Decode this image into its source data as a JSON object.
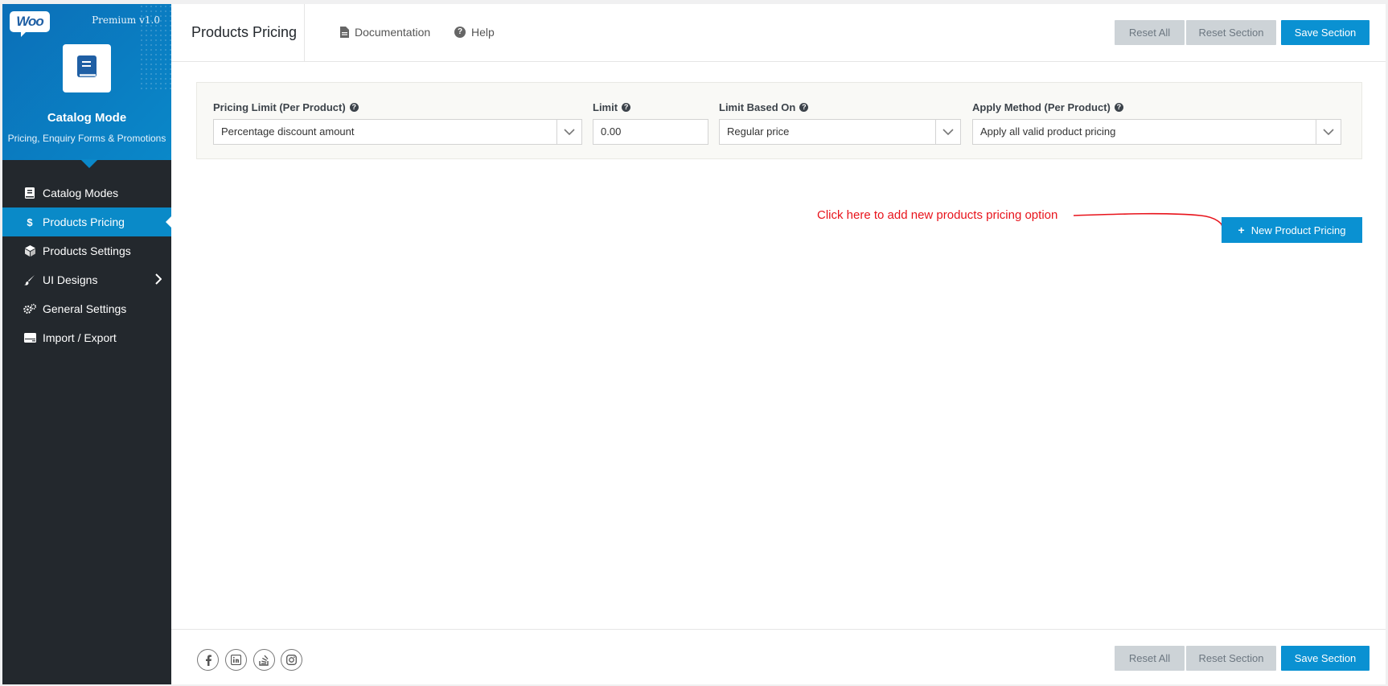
{
  "sidebar": {
    "logo_text": "Woo",
    "version": "Premium v1.0",
    "title": "Catalog Mode",
    "subtitle": "Pricing, Enquiry Forms & Promotions",
    "items": [
      {
        "label": "Catalog Modes",
        "icon": "book-icon"
      },
      {
        "label": "Products Pricing",
        "icon": "dollar-icon",
        "active": true
      },
      {
        "label": "Products Settings",
        "icon": "cube-icon"
      },
      {
        "label": "UI Designs",
        "icon": "brush-icon"
      },
      {
        "label": "General Settings",
        "icon": "cogs-icon"
      },
      {
        "label": "Import / Export",
        "icon": "hdd-icon"
      }
    ]
  },
  "header": {
    "title": "Products Pricing",
    "documentation": "Documentation",
    "help": "Help",
    "reset_all": "Reset All",
    "reset_section": "Reset Section",
    "save_section": "Save Section"
  },
  "filters": {
    "pricing_limit_label": "Pricing Limit (Per Product)",
    "pricing_limit_value": "Percentage discount amount",
    "limit_label": "Limit",
    "limit_value": "0.00",
    "limit_based_label": "Limit Based On",
    "limit_based_value": "Regular price",
    "apply_method_label": "Apply Method (Per Product)",
    "apply_method_value": "Apply all valid product pricing"
  },
  "annotation": {
    "text": "Click here to add new products pricing option",
    "color": "#e8131b"
  },
  "new_button": "New Product Pricing",
  "footer": {
    "reset_all": "Reset All",
    "reset_section": "Reset Section",
    "save_section": "Save Section",
    "social": [
      "facebook-icon",
      "linkedin-icon",
      "stackoverflow-icon",
      "instagram-icon"
    ]
  },
  "colors": {
    "accent": "#0a91d2",
    "sidebar_bg": "#23282d",
    "grey_button": "#cdd3d7"
  }
}
